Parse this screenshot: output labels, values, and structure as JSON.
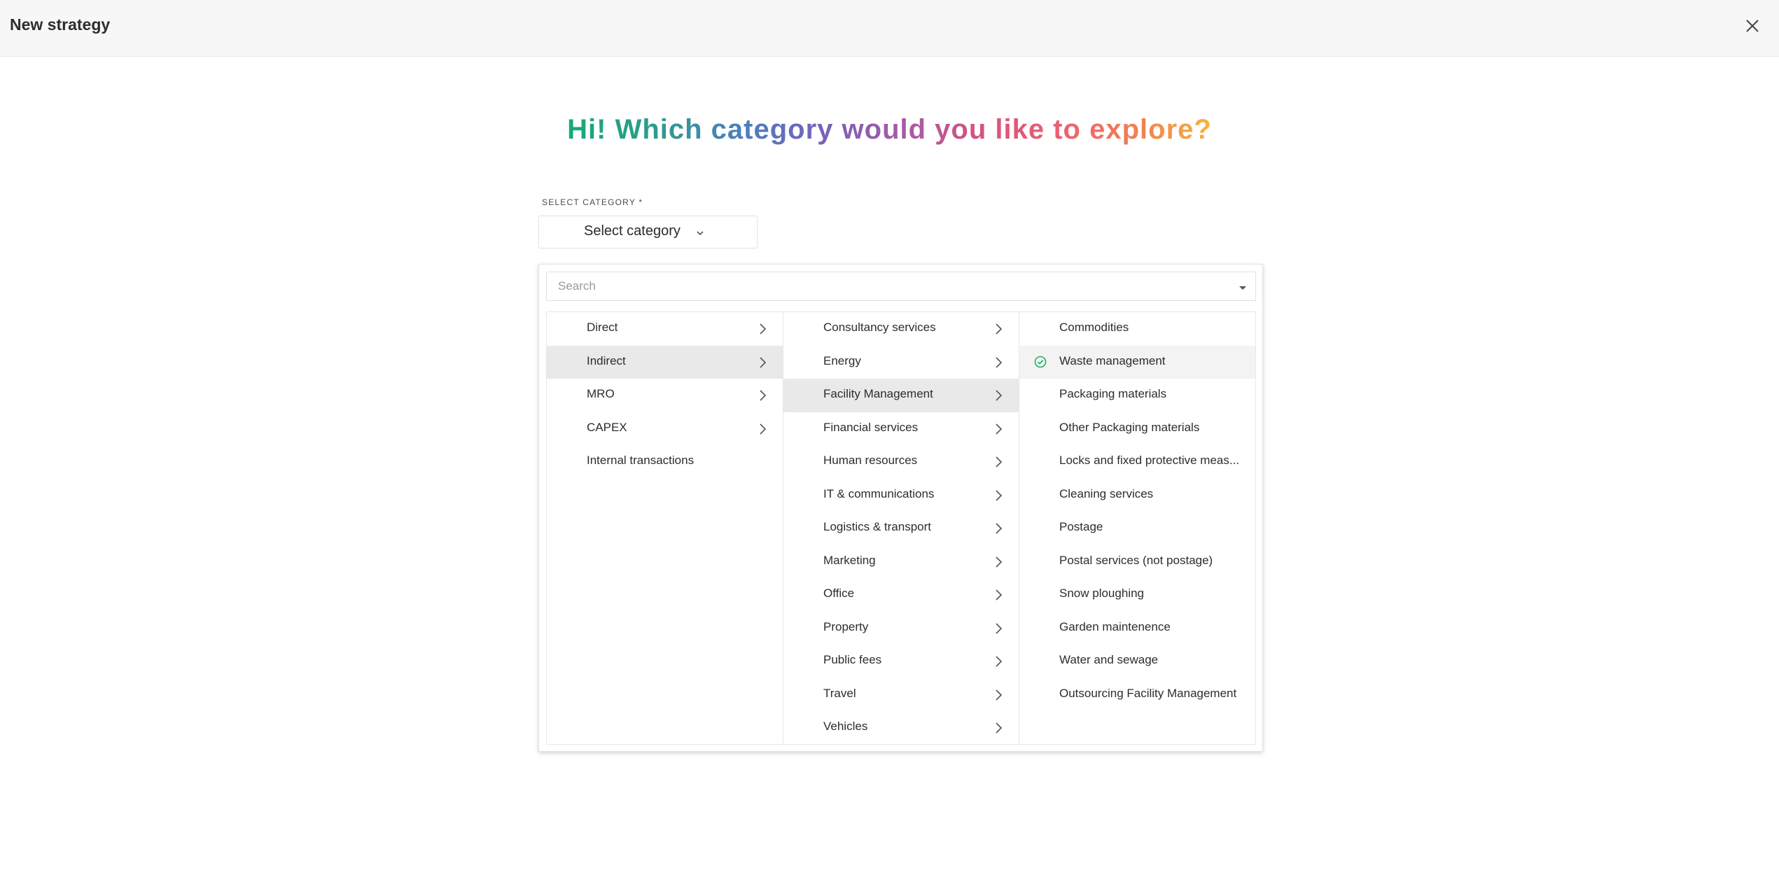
{
  "header": {
    "title": "New strategy",
    "close_icon": "close-icon"
  },
  "headline": "Hi! Which category would you like to explore?",
  "category_field": {
    "label": "SELECT CATEGORY *",
    "value": "Select category",
    "chevron_icon": "chevron-down-icon"
  },
  "dropdown": {
    "search_placeholder": "Search",
    "search_caret_icon": "caret-down-icon",
    "level1": [
      {
        "label": "Direct",
        "has_children": true
      },
      {
        "label": "Indirect",
        "has_children": true,
        "selected": true
      },
      {
        "label": "MRO",
        "has_children": true
      },
      {
        "label": "CAPEX",
        "has_children": true
      },
      {
        "label": "Internal transactions",
        "has_children": false
      }
    ],
    "level2": [
      {
        "label": "Consultancy services",
        "has_children": true
      },
      {
        "label": "Energy",
        "has_children": true
      },
      {
        "label": "Facility Management",
        "has_children": true,
        "selected": true
      },
      {
        "label": "Financial services",
        "has_children": true
      },
      {
        "label": "Human resources",
        "has_children": true
      },
      {
        "label": "IT & communications",
        "has_children": true
      },
      {
        "label": "Logistics & transport",
        "has_children": true
      },
      {
        "label": "Marketing",
        "has_children": true
      },
      {
        "label": "Office",
        "has_children": true
      },
      {
        "label": "Property",
        "has_children": true
      },
      {
        "label": "Public fees",
        "has_children": true
      },
      {
        "label": "Travel",
        "has_children": true
      },
      {
        "label": "Vehicles",
        "has_children": true
      }
    ],
    "level3": [
      {
        "label": "Commodities"
      },
      {
        "label": "Waste management",
        "checked": true
      },
      {
        "label": "Packaging materials"
      },
      {
        "label": "Other Packaging materials"
      },
      {
        "label": "Locks and fixed protective meas..."
      },
      {
        "label": "Cleaning services"
      },
      {
        "label": "Postage"
      },
      {
        "label": "Postal services (not postage)"
      },
      {
        "label": "Snow ploughing"
      },
      {
        "label": "Garden maintenence"
      },
      {
        "label": "Water and sewage"
      },
      {
        "label": "Outsourcing Facility Management"
      }
    ]
  },
  "colors": {
    "check": "#27ae60",
    "selected_row": "#e9e9e9",
    "checked_row": "#f3f3f3"
  }
}
